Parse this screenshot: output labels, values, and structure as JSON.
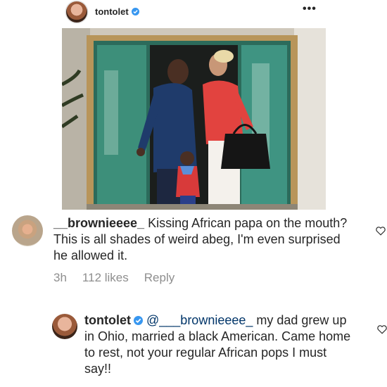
{
  "post": {
    "username": "tontolet",
    "more_label": "•••"
  },
  "comments": [
    {
      "username": "__brownieeee_",
      "text": " Kissing African papa on the mouth? This is all shades of weird abeg, I'm even surprised he allowed it.",
      "time": "3h",
      "likes": "112 likes",
      "reply": "Reply"
    },
    {
      "username": "tontolet",
      "mention": "@___brownieeee_",
      "text": " my dad grew up in Ohio, married a black American. Came home to rest, not your regular African pops I must say!!"
    }
  ],
  "colors": {
    "verified": "#3897f0",
    "text": "#262626",
    "meta": "#8e8e8e",
    "mention": "#003569"
  },
  "icons": [
    "verified-icon",
    "more-icon",
    "heart-icon"
  ]
}
